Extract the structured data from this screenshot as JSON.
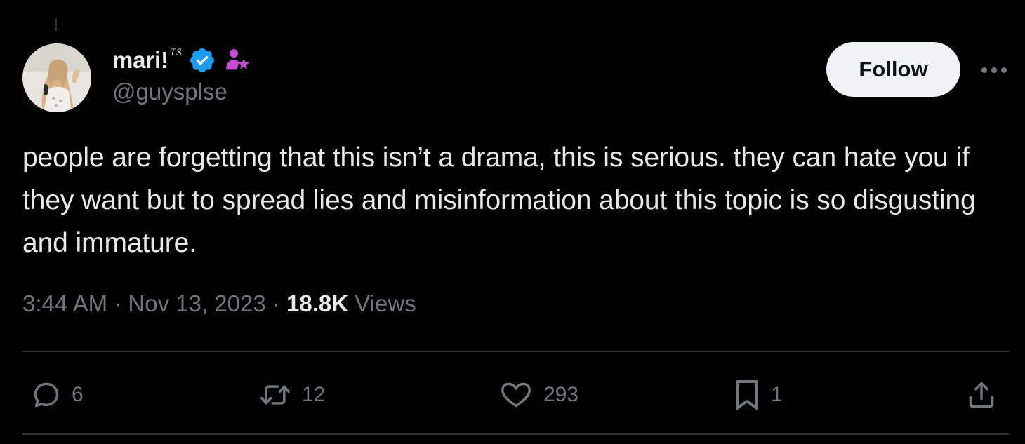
{
  "author": {
    "display_name": "mari!",
    "name_superscript": "TS",
    "handle": "@guysplse",
    "avatar_icon": "person-photo-avatar",
    "verified_icon": "verified-badge-icon",
    "affiliate_icon": "person-star-icon",
    "verified_color": "#1d9bf0",
    "affiliate_color": "#c84bd6"
  },
  "header": {
    "follow_label": "Follow",
    "more_icon": "more-dots-icon"
  },
  "tweet": {
    "text": "people are forgetting that this isn’t a drama, this is serious. they can hate you if they want but to spread lies and misinformation about this topic is so disgusting and immature."
  },
  "meta": {
    "time": "3:44 AM",
    "separator": " · ",
    "date": "Nov 13, 2023",
    "views_count": "18.8K",
    "views_label": "Views"
  },
  "actions": {
    "replies": "6",
    "reposts": "12",
    "likes": "293",
    "bookmarks": "1"
  },
  "colors": {
    "background": "#000000",
    "text_primary": "#e7e9ea",
    "text_secondary": "#71767b",
    "divider": "#2f3336",
    "follow_bg": "#eff3f4"
  }
}
